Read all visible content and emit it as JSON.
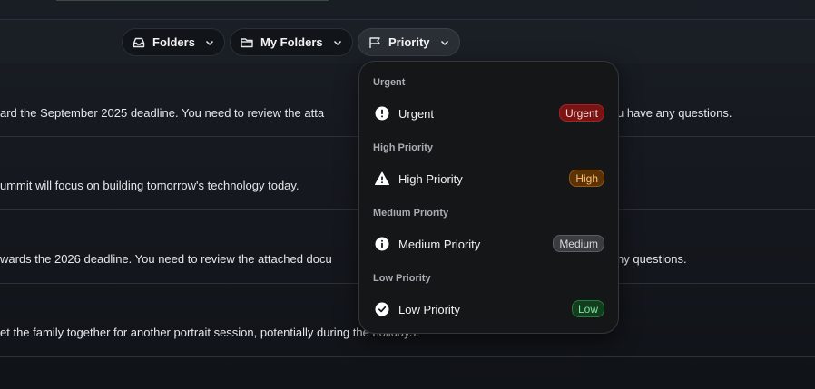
{
  "toolbar": {
    "folders_label": "Folders",
    "my_folders_label": "My Folders",
    "priority_label": "Priority"
  },
  "messages": [
    "ard the September 2025 deadline. You need to review the atta",
    "u have any questions.",
    "ummit will focus on building tomorrow's technology today.",
    "wards the 2026 deadline. You need to review the attached docu",
    "ny questions.",
    "et the family together for another portrait session, potentially during the holidays."
  ],
  "dropdown": {
    "groups": [
      {
        "heading": "Urgent",
        "item": "Urgent",
        "badge": "Urgent",
        "icon": "alert-circle-icon"
      },
      {
        "heading": "High Priority",
        "item": "High Priority",
        "badge": "High",
        "icon": "warning-triangle-icon"
      },
      {
        "heading": "Medium Priority",
        "item": "Medium Priority",
        "badge": "Medium",
        "icon": "info-circle-icon"
      },
      {
        "heading": "Low Priority",
        "item": "Low Priority",
        "badge": "Low",
        "icon": "check-circle-icon"
      }
    ]
  },
  "colors": {
    "urgent": "#7a1414",
    "high": "#5b3206",
    "medium": "#3a3c40",
    "low": "#123d1f"
  }
}
